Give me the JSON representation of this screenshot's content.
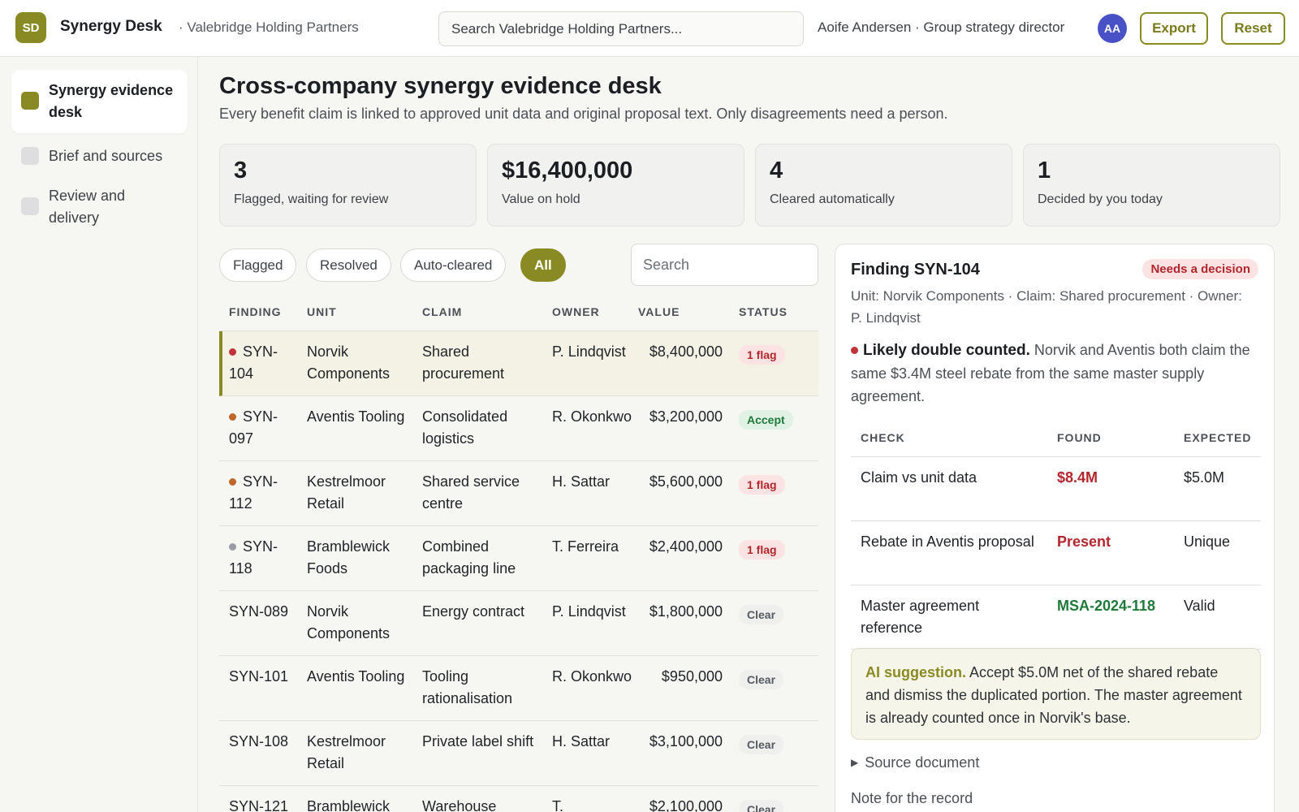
{
  "app": {
    "logo": "SD",
    "name": "Synergy Desk",
    "company": "· Valebridge Holding Partners",
    "search_placeholder": "Search Valebridge Holding Partners...",
    "user": "Aoife Andersen · Group strategy director",
    "avatar": "AA",
    "export_label": "Export",
    "reset_label": "Reset"
  },
  "sidebar": {
    "items": [
      {
        "label": "Synergy evidence desk",
        "active": true
      },
      {
        "label": "Brief and sources",
        "active": false
      },
      {
        "label": "Review and delivery",
        "active": false
      }
    ]
  },
  "page": {
    "title": "Cross-company synergy evidence desk",
    "subtitle": "Every benefit claim is linked to approved unit data and original proposal text. Only disagreements need a person."
  },
  "kpis": [
    {
      "value": "3",
      "label": "Flagged, waiting for review"
    },
    {
      "value": "$16,400,000",
      "label": "Value on hold"
    },
    {
      "value": "4",
      "label": "Cleared automatically"
    },
    {
      "value": "1",
      "label": "Decided by you today"
    }
  ],
  "filters": {
    "chips": [
      "Flagged",
      "Resolved",
      "Auto-cleared",
      "All"
    ],
    "active": "All",
    "search_placeholder": "Search"
  },
  "table": {
    "headers": [
      "FINDING",
      "UNIT",
      "CLAIM",
      "OWNER",
      "VALUE",
      "STATUS"
    ],
    "rows": [
      {
        "finding": "SYN-104",
        "unit": "Norvik Components",
        "claim": "Shared procurement",
        "owner": "P. Lindqvist",
        "value": "$8,400,000",
        "status": "1 flag",
        "kind": "flag",
        "dot": "#c0343a",
        "selected": true
      },
      {
        "finding": "SYN-097",
        "unit": "Aventis Tooling",
        "claim": "Consolidated logistics",
        "owner": "R. Okonkwo",
        "value": "$3,200,000",
        "status": "Accept",
        "kind": "accept",
        "dot": "#c0662a",
        "selected": false
      },
      {
        "finding": "SYN-112",
        "unit": "Kestrelmoor Retail",
        "claim": "Shared service centre",
        "owner": "H. Sattar",
        "value": "$5,600,000",
        "status": "1 flag",
        "kind": "flag",
        "dot": "#c0662a",
        "selected": false
      },
      {
        "finding": "SYN-118",
        "unit": "Bramblewick Foods",
        "claim": "Combined packaging line",
        "owner": "T. Ferreira",
        "value": "$2,400,000",
        "status": "1 flag",
        "kind": "flag",
        "dot": "#9a9ca6",
        "selected": false
      },
      {
        "finding": "SYN-089",
        "unit": "Norvik Components",
        "claim": "Energy contract",
        "owner": "P. Lindqvist",
        "value": "$1,800,000",
        "status": "Clear",
        "kind": "clear",
        "dot": "",
        "selected": false
      },
      {
        "finding": "SYN-101",
        "unit": "Aventis Tooling",
        "claim": "Tooling rationalisation",
        "owner": "R. Okonkwo",
        "value": "$950,000",
        "status": "Clear",
        "kind": "clear",
        "dot": "",
        "selected": false
      },
      {
        "finding": "SYN-108",
        "unit": "Kestrelmoor Retail",
        "claim": "Private label shift",
        "owner": "H. Sattar",
        "value": "$3,100,000",
        "status": "Clear",
        "kind": "clear",
        "dot": "",
        "selected": false
      },
      {
        "finding": "SYN-121",
        "unit": "Bramblewick",
        "claim": "Warehouse",
        "owner": "T.",
        "value": "$2,100,000",
        "status": "Clear",
        "kind": "clear",
        "dot": "",
        "selected": false
      }
    ]
  },
  "detail": {
    "title": "Finding SYN-104",
    "badge": "Needs a decision",
    "meta": "Unit: Norvik Components · Claim: Shared procurement · Owner: P. Lindqvist",
    "finding_bold": "Likely double counted.",
    "finding_text": " Norvik and Aventis both claim the same $3.4M steel rebate from the same master supply agreement.",
    "check_headers": [
      "CHECK",
      "FOUND",
      "EXPECTED"
    ],
    "checks": [
      {
        "check": "Claim vs unit data",
        "found": "$8.4M",
        "expected": "$5.0M",
        "tone": "red"
      },
      {
        "check": "Rebate in Aventis proposal",
        "found": "Present",
        "expected": "Unique",
        "tone": "red"
      },
      {
        "check": "Master agreement reference",
        "found": "MSA-2024-118",
        "expected": "Valid",
        "tone": "green"
      }
    ],
    "ai_label": "AI suggestion.",
    "ai_text": " Accept $5.0M net of the shared rebate and dismiss the duplicated portion. The master agreement is already counted once in Norvik's base.",
    "source_label": "Source document",
    "note_label": "Note for the record"
  }
}
